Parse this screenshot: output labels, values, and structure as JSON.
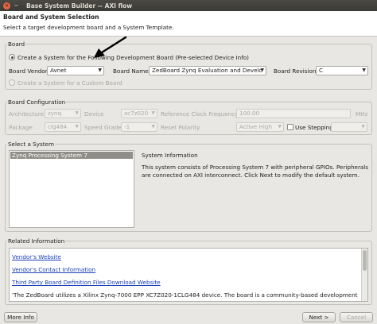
{
  "window": {
    "title": "Base System Builder -- AXI flow",
    "close_glyph": "×",
    "min_glyph": "−"
  },
  "header": {
    "title": "Board and System Selection",
    "subtitle": "Select a target development board and a System Template."
  },
  "board": {
    "group_label": "Board",
    "radio_preselected_label": "Create a System for the Following Development Board (Pre-selected Device Info)",
    "vendor_label": "Board Vendor",
    "vendor_value": "Avnet",
    "name_label": "Board Name",
    "name_value": "ZedBoard Zynq Evaluation and Develc",
    "revision_label": "Board Revision",
    "revision_value": "C",
    "radio_custom_label": "Create a System for a Custom Board"
  },
  "board_config": {
    "group_label": "Board Configuration",
    "architecture_label": "Architecture",
    "architecture_value": "zynq",
    "device_label": "Device",
    "device_value": "xc7z020",
    "ref_clock_label": "Reference Clock Frequency",
    "ref_clock_value": "100.00",
    "ref_clock_unit": "MHz",
    "package_label": "Package",
    "package_value": "clg484",
    "speed_label": "Speed Grade",
    "speed_value": "-1",
    "reset_label": "Reset Polarity",
    "reset_value": "Active High",
    "stepping_label": "Use Stepping",
    "stepping_value": ""
  },
  "system": {
    "group_label": "Select a System",
    "items": [
      "Zynq Processing System 7"
    ],
    "info_title": "System Information",
    "info_text_lines": [
      "This system consists of Processing System 7 with peripheral GPIOs. Peripherals",
      "are connected on AXI interconnect. Click Next to modify the default system."
    ]
  },
  "related": {
    "group_label": "Related Information",
    "links": [
      "Vendor's Website",
      "Vendor's Contact Information",
      "Third Party Board Definition Files Download Website"
    ],
    "description": "'The ZedBoard utilizes a Xilinx Zynq-7000 EPP XC7Z020-1CLG484 device. The board is a community-based development board,"
  },
  "footer": {
    "more_info": "More Info",
    "next": "Next >",
    "cancel": "Cancel"
  },
  "colors": {
    "link": "#1a3fb8",
    "selection": "#8f8e88",
    "titlebar": "#3b3a36"
  },
  "icons": {
    "window_close": "close-icon",
    "window_minimize": "minimize-icon",
    "annotation": "arrow-annotation"
  }
}
